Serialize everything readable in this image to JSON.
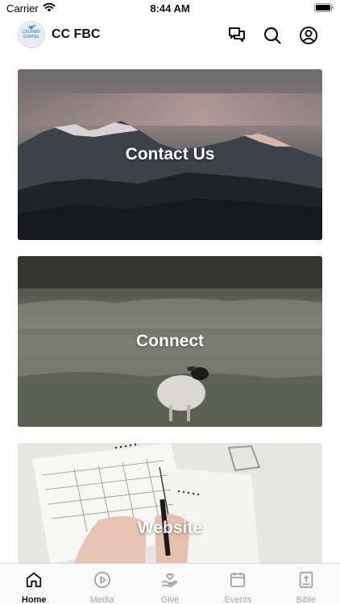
{
  "status_bar": {
    "carrier": "Carrier",
    "time": "8:44 AM"
  },
  "header": {
    "logo_text": "CALVARY CHAPEL",
    "title": "CC FBC",
    "icons": [
      "chat-icon",
      "search-icon",
      "profile-icon"
    ]
  },
  "cards": [
    {
      "label": "Contact Us",
      "image": "mountain-landscape"
    },
    {
      "label": "Connect",
      "image": "sheep-in-field"
    },
    {
      "label": "Website",
      "image": "hands-writing-planner"
    }
  ],
  "tab_bar": {
    "items": [
      {
        "label": "Home",
        "icon": "home-icon",
        "active": true
      },
      {
        "label": "Media",
        "icon": "play-icon",
        "active": false
      },
      {
        "label": "Give",
        "icon": "give-hand-icon",
        "active": false
      },
      {
        "label": "Events",
        "icon": "calendar-icon",
        "active": false
      },
      {
        "label": "Bible",
        "icon": "bible-icon",
        "active": false
      }
    ]
  },
  "colors": {
    "tab_active": "#111111",
    "tab_inactive": "#a3a3a3",
    "logo_accent": "#5a90c4"
  }
}
